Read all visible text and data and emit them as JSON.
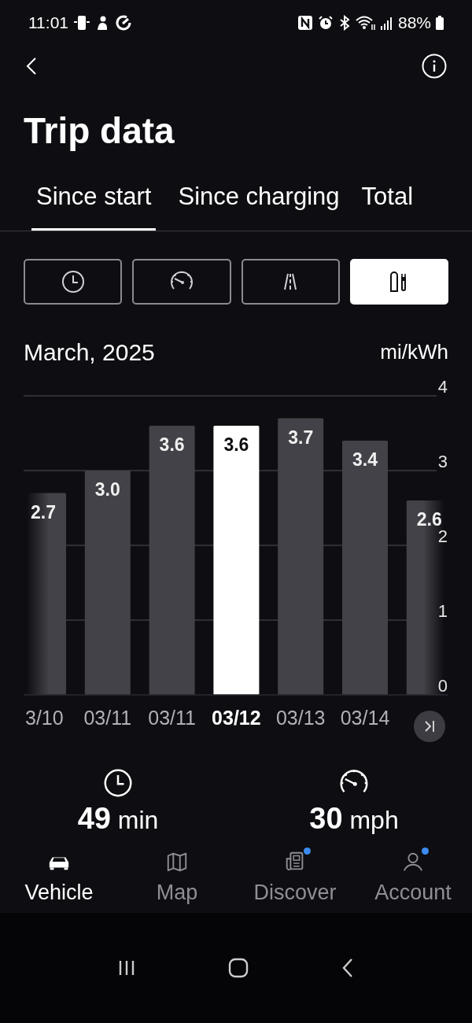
{
  "status_bar": {
    "time": "11:01",
    "battery": "88%"
  },
  "title": "Trip data",
  "tabs": [
    {
      "label": "Since start",
      "selected": true
    },
    {
      "label": "Since charging",
      "selected": false
    },
    {
      "label": "Total",
      "selected": false
    }
  ],
  "modes": [
    {
      "kind": "clock",
      "selected": false
    },
    {
      "kind": "speed",
      "selected": false
    },
    {
      "kind": "road",
      "selected": false
    },
    {
      "kind": "charging",
      "selected": true
    }
  ],
  "chart": {
    "period": "March, 2025",
    "unit": "mi/kWh",
    "selected_bars": [
      false,
      false,
      false,
      true,
      false,
      false,
      false
    ],
    "chart_data": {
      "type": "bar",
      "categories": [
        "3/10",
        "03/11",
        "03/11",
        "03/12",
        "03/13",
        "03/14",
        null
      ],
      "values": [
        2.7,
        3.0,
        3.6,
        3.6,
        3.7,
        3.4,
        2.6
      ],
      "ylim": [
        0,
        4
      ],
      "yticks": [
        0,
        1,
        2,
        3,
        4
      ],
      "grid": true,
      "value_labels": [
        "2.7",
        "3.0",
        "3.6",
        "3.6",
        "3.7",
        "3.4",
        "2.6"
      ]
    }
  },
  "stats": [
    {
      "kind": "clock",
      "value": "**49** min"
    },
    {
      "kind": "speed",
      "value": "**30** mph"
    }
  ],
  "nav": [
    {
      "kind": "car",
      "label": "Vehicle",
      "selected": true,
      "badge": false
    },
    {
      "kind": "map",
      "label": "Map",
      "selected": false,
      "badge": false
    },
    {
      "kind": "news",
      "label": "Discover",
      "selected": false,
      "badge": true
    },
    {
      "kind": "person",
      "label": "Account",
      "selected": false,
      "badge": true
    }
  ]
}
